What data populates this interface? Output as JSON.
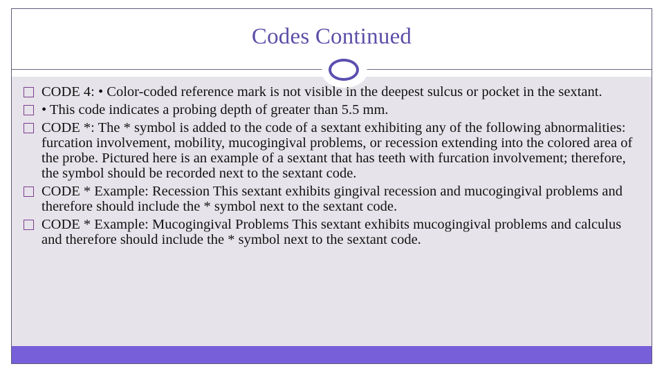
{
  "slide": {
    "title": "Codes Continued",
    "accent_color": "#765fd8",
    "title_color": "#5b4fa8",
    "bullet_icon": "square-bullet-icon",
    "bullets": [
      {
        "text": "CODE 4: • Color-coded reference mark is not visible in the deepest sulcus or pocket in the sextant."
      },
      {
        "text": "• This code indicates a probing depth of greater than 5.5 mm."
      },
      {
        "text": "CODE *: The * symbol is added to the code of a sextant exhibiting any of the following abnormalities: furcation involvement, mobility, mucogingival problems, or recession extending into the colored area of the probe. Pictured here is an example of a sextant that has teeth with furcation involvement; therefore, the symbol should be recorded next to the sextant code."
      },
      {
        "text": "CODE * Example: Recession This sextant exhibits gingival recession and mucogingival problems and therefore should include the * symbol next to the sextant code."
      },
      {
        "text": "CODE * Example: Mucogingival Problems This sextant exhibits mucogingival problems and calculus and therefore should include the * symbol next to the sextant code."
      }
    ]
  }
}
